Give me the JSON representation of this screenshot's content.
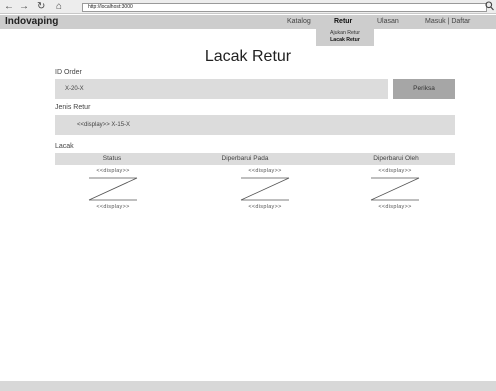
{
  "browser": {
    "back": "←",
    "forward": "→",
    "reload": "↻",
    "home": "⌂",
    "url": "http://localhost:3000",
    "search_icon": "magnifier"
  },
  "header": {
    "brand": "Indovaping",
    "nav": [
      "Katalog",
      "Retur",
      "Ulasan",
      "Masuk | Daftar"
    ],
    "active_nav": "Retur"
  },
  "dropdown": {
    "items": [
      "Ajukan Retur",
      "Lacak Retur"
    ],
    "active": "Lacak Retur"
  },
  "main": {
    "title": "Lacak Retur",
    "order_label": "ID Order",
    "order_value": "X-20-X",
    "check_button": "Periksa",
    "return_type_label": "Jenis Retur",
    "return_type_value": "<<display>> X-15-X",
    "track_label": "Lacak",
    "columns": [
      "Status",
      "Diperbarui Pada",
      "Diperbarui Oleh"
    ],
    "cells": [
      {
        "top": "<<display>>",
        "bottom": "<<display>>"
      },
      {
        "top": "<<display>>",
        "bottom": "<<display>>"
      },
      {
        "top": "<<display>>",
        "bottom": "<<display>>"
      }
    ]
  },
  "colors": {
    "header_bg": "#cdcdcd",
    "field_bg": "#dcdcdc",
    "button_bg": "#a6a6a6"
  }
}
